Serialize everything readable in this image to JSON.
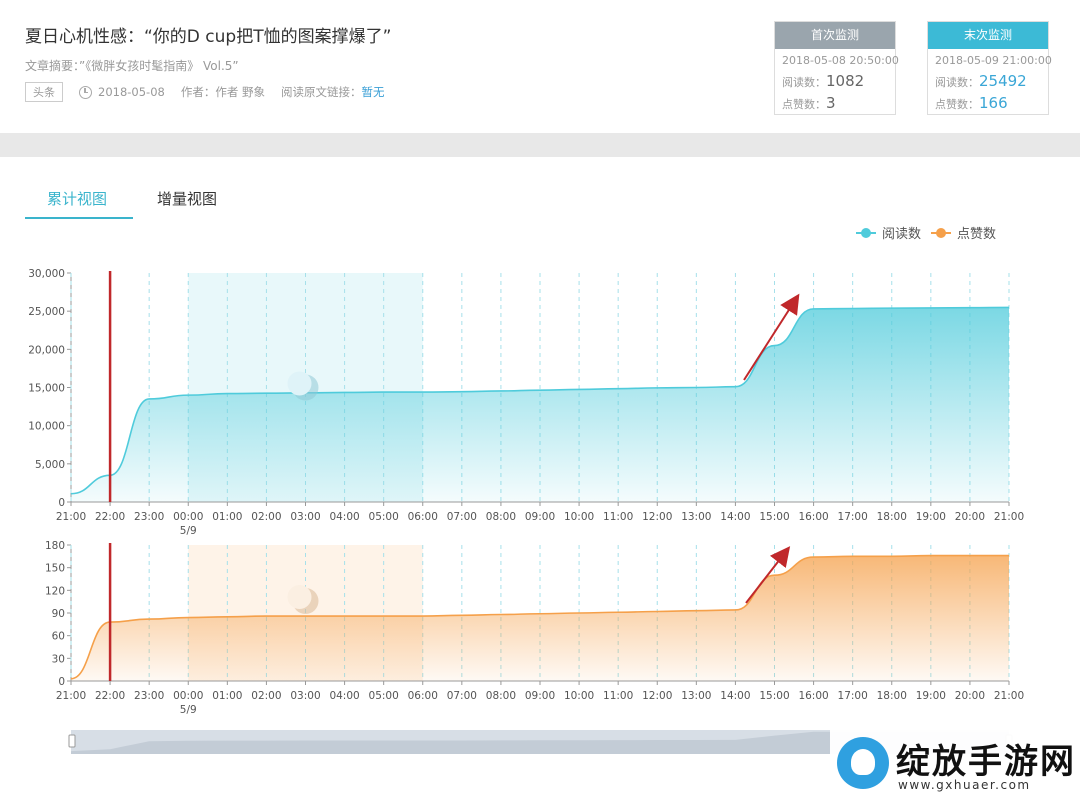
{
  "article": {
    "title": "夏日心机性感：“你的D cup把T恤的图案撑爆了”",
    "summary": "文章摘要：”《微胖女孩时髦指南》 Vol.5”",
    "tag": "头条",
    "date": "2018-05-08",
    "author": "作者：作者 野象",
    "link_label": "阅读原文链接：",
    "link_value": "暂无"
  },
  "first_monitor": {
    "title": "首次监测",
    "time": "2018-05-08 20:50:00",
    "reads_label": "阅读数：",
    "reads": "1082",
    "likes_label": "点赞数：",
    "likes": "3",
    "color": "#9aa5ad"
  },
  "last_monitor": {
    "title": "末次监测",
    "time": "2018-05-09 21:00:00",
    "reads_label": "阅读数：",
    "reads": "25492",
    "likes_label": "点赞数：",
    "likes": "166",
    "color": "#3cbad6"
  },
  "tabs": [
    {
      "label": "累计视图",
      "active": true
    },
    {
      "label": "增量视图",
      "active": false
    }
  ],
  "legend": [
    {
      "label": "阅读数",
      "color": "#4fcbdb"
    },
    {
      "label": "点赞数",
      "color": "#f5a04a"
    }
  ],
  "icons": [
    "clock-icon",
    "moon-icon",
    "trend-arrow-icon",
    "slider-handle-icon"
  ],
  "watermark": {
    "text": "绽放手游网",
    "url": "www.gxhuaer.com"
  },
  "chart_data": [
    {
      "type": "area",
      "name": "阅读数",
      "color": "#4fcbdb",
      "x": [
        "21:00",
        "22:00",
        "23:00",
        "00:00",
        "01:00",
        "02:00",
        "03:00",
        "04:00",
        "05:00",
        "06:00",
        "07:00",
        "08:00",
        "09:00",
        "10:00",
        "11:00",
        "12:00",
        "13:00",
        "14:00",
        "15:00",
        "16:00",
        "17:00",
        "18:00",
        "19:00",
        "20:00",
        "21:00"
      ],
      "x_sublabel": {
        "index": 3,
        "text": "5/9"
      },
      "values": [
        1082,
        3500,
        13500,
        14000,
        14200,
        14250,
        14300,
        14350,
        14400,
        14400,
        14450,
        14550,
        14650,
        14750,
        14850,
        14950,
        15000,
        15100,
        20500,
        25300,
        25350,
        25400,
        25420,
        25450,
        25492
      ],
      "yticks": [
        "0",
        "5,000",
        "10,000",
        "15,000",
        "20,000",
        "25,000",
        "30,000"
      ],
      "ylim": [
        0,
        30000
      ],
      "night_band": [
        "00:00",
        "06:00"
      ],
      "marker_line": "22:00"
    },
    {
      "type": "area",
      "name": "点赞数",
      "color": "#f5a04a",
      "x": [
        "21:00",
        "22:00",
        "23:00",
        "00:00",
        "01:00",
        "02:00",
        "03:00",
        "04:00",
        "05:00",
        "06:00",
        "07:00",
        "08:00",
        "09:00",
        "10:00",
        "11:00",
        "12:00",
        "13:00",
        "14:00",
        "15:00",
        "16:00",
        "17:00",
        "18:00",
        "19:00",
        "20:00",
        "21:00"
      ],
      "x_sublabel": {
        "index": 3,
        "text": "5/9"
      },
      "values": [
        3,
        78,
        82,
        84,
        85,
        86,
        86,
        86,
        86,
        86,
        87,
        88,
        89,
        90,
        91,
        92,
        93,
        94,
        140,
        164,
        165,
        165,
        166,
        166,
        166
      ],
      "yticks": [
        "0",
        "30",
        "60",
        "90",
        "120",
        "150",
        "180"
      ],
      "ylim": [
        0,
        180
      ],
      "night_band": [
        "00:00",
        "06:00"
      ],
      "marker_line": "22:00"
    }
  ]
}
